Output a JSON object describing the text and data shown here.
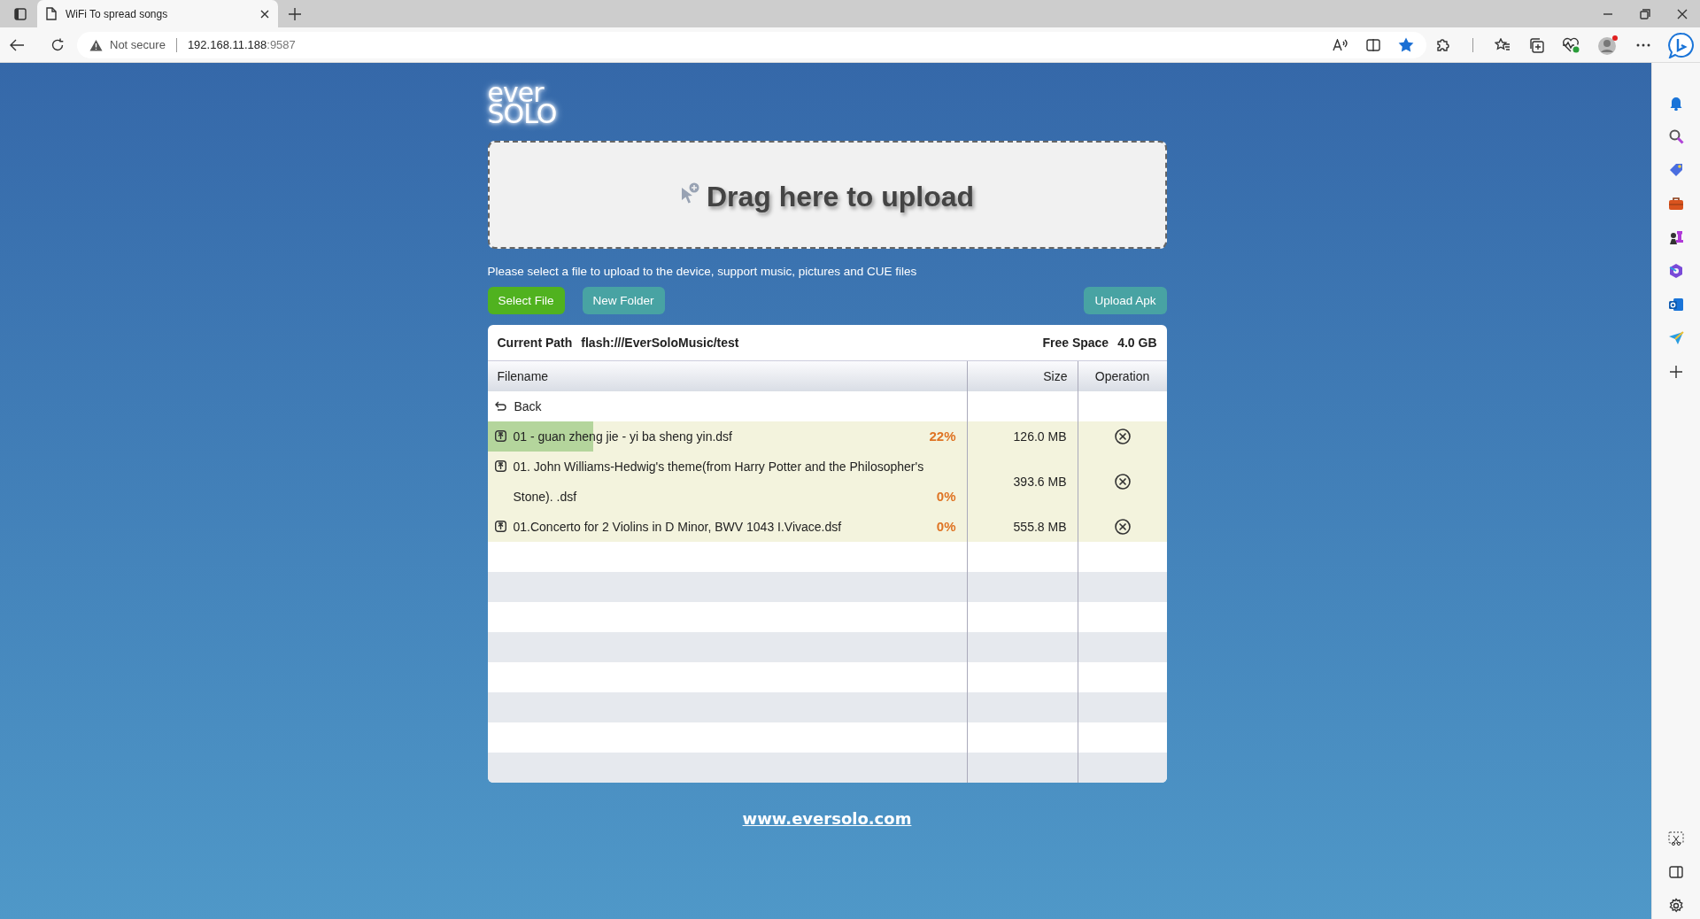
{
  "browser": {
    "tab": {
      "title": "WiFi To spread songs",
      "selected": true
    },
    "security": "Not secure",
    "address": {
      "host": "192.168.11.188",
      "port": ":9587"
    }
  },
  "logo": {
    "line_1": "ever",
    "line_2": "SOLO"
  },
  "drop_zone": {
    "label": "Drag here to upload"
  },
  "hint": "Please select a file to upload to the device, support music, pictures and CUE files",
  "left_buttons": [
    {
      "label": "Select File",
      "kind": "primary"
    },
    {
      "label": "New Folder",
      "kind": "secondary"
    }
  ],
  "right_buttons": [
    {
      "label": "Upload Apk",
      "kind": "secondary"
    }
  ],
  "path_bar": {
    "path_label": "Current Path",
    "path": "flash:///EverSoloMusic/test",
    "space_label": "Free Space",
    "space": "4.0 GB"
  },
  "table": {
    "columns": [
      "Filename",
      "Size",
      "Operation"
    ],
    "back_row": {
      "label": "Back"
    },
    "rows": [
      {
        "name": "01 - guan zheng jie - yi ba sheng yin.dsf",
        "progress": "22%",
        "level": 0.22,
        "size": "126.0 MB"
      },
      {
        "name": "01. John Williams-Hedwig's theme(from Harry Potter and the Philosopher's Stone). .dsf",
        "progress": "0%",
        "level": 0,
        "size": "393.6 MB"
      },
      {
        "name": "01.Concerto for 2 Violins in D Minor, BWV 1043 I.Vivace.dsf",
        "progress": "0%",
        "level": 0,
        "size": "555.8 MB"
      }
    ]
  },
  "footer_link": "www.eversolo.com"
}
